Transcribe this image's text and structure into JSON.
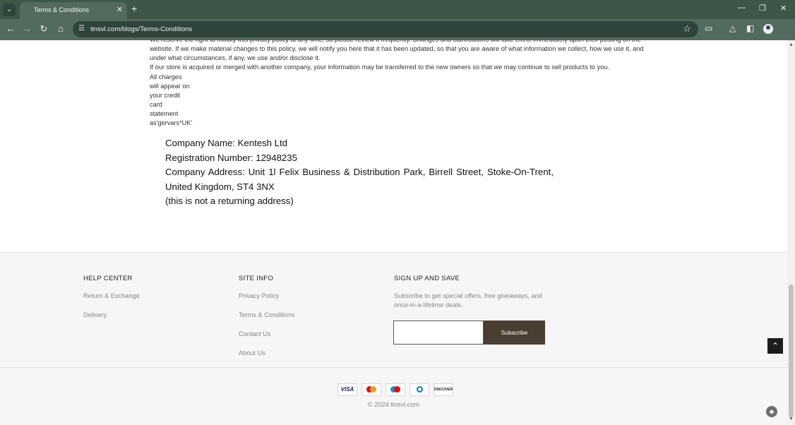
{
  "browser": {
    "tab_title": "Terms & Conditions",
    "url": "tinsvl.com/blogs/Terms-Conditions"
  },
  "content": {
    "policy_paragraph_1": "We reserve the right to modify this privacy policy at any time, so please review it frequently. Changes and clarifications will take effect immediately upon their posting on the website. If we make material changes to this policy, we will notify you here that it has been updated, so that you are aware of what information we collect, how we use it, and under what circumstances, if any, we use and/or disclose it.",
    "policy_paragraph_2": "If our store is acquired or merged with another company, your information may be transferred to the new owners so that we may continue to sell products to you.",
    "charges_lines": [
      "All charges",
      "will appear on",
      "your credit",
      "card",
      "statement",
      "as'gervars*UK'"
    ],
    "company_name": "Company Name: Kentesh Ltd",
    "registration_number": "Registration Number: 12948235",
    "company_address_line1": "Company Address: Unit 1l Felix Business & Distribution Park, Birrell Street, Stoke-On-Trent,",
    "company_address_line2": "United Kingdom, ST4 3NX",
    "address_note": "(this is not a returning address)"
  },
  "footer": {
    "help_center": {
      "title": "HELP CENTER",
      "links": [
        "Return & Exchange",
        "Delivery"
      ]
    },
    "site_info": {
      "title": "SITE INFO",
      "links": [
        "Privacy Policy",
        "Terms & Conditions",
        "Contact Us",
        "About Us"
      ]
    },
    "signup": {
      "title": "SIGN UP AND SAVE",
      "text": "Subscribe to get special offers, free giveaways, and once-in-a-lifetime deals.",
      "email_placeholder": "",
      "button_label": "Subscribe"
    },
    "payments": {
      "visa": "VISA",
      "discover": "DISCOVER",
      "icons": [
        "visa-icon",
        "mastercard-icon",
        "maestro-icon",
        "diners-club-icon",
        "discover-icon"
      ]
    },
    "copyright": "© 2024 tinsvl.com"
  },
  "colors": {
    "chrome_dark": "#3e5548",
    "chrome_mid": "#536b5e",
    "subscribe_button": "#4a3d31"
  }
}
